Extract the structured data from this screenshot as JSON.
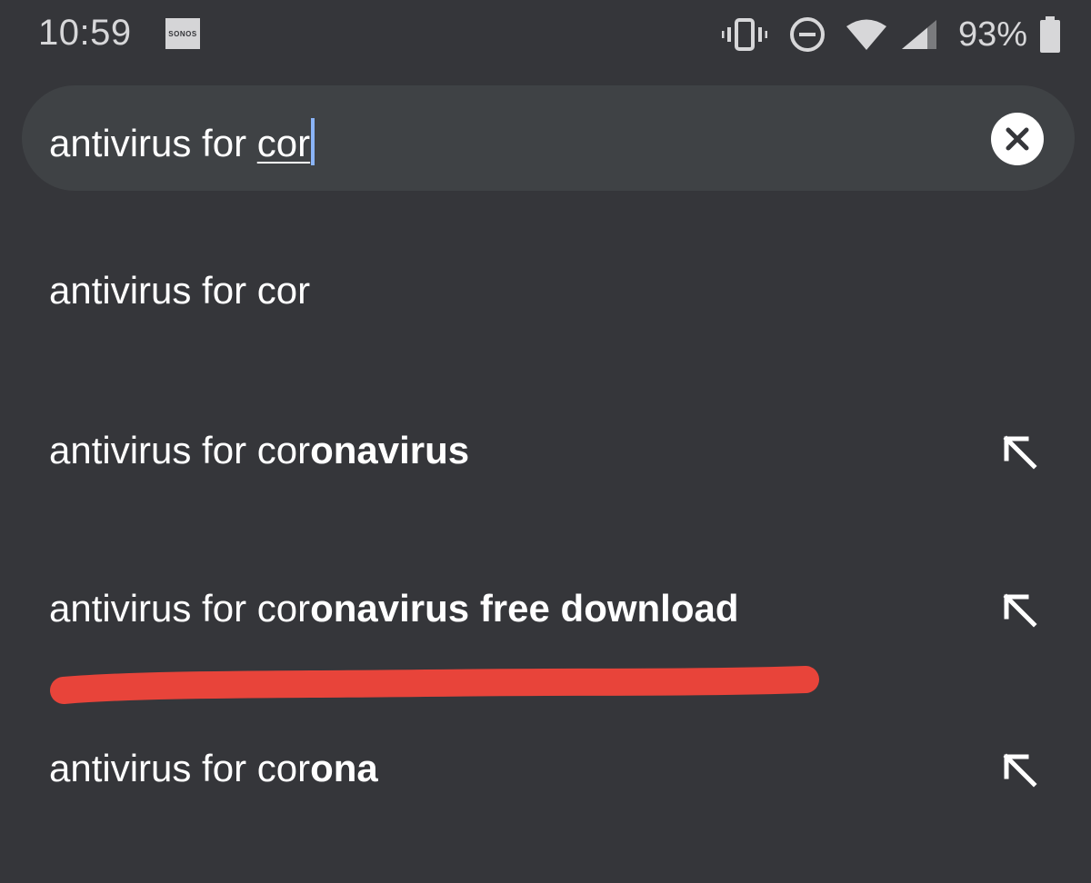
{
  "status_bar": {
    "time": "10:59",
    "notification_badge": "SONOS",
    "battery_percent": "93%",
    "icons": [
      "vibrate-icon",
      "do-not-disturb-icon",
      "wifi-icon",
      "cell-signal-icon",
      "battery-icon"
    ]
  },
  "search": {
    "prefix": "antivirus for ",
    "typed": "cor",
    "clear_icon": "close-icon"
  },
  "suggestions": [
    {
      "normal": "antivirus for cor",
      "bold": "",
      "has_fill_arrow": false
    },
    {
      "normal": "antivirus for cor",
      "bold": "onavirus",
      "has_fill_arrow": true
    },
    {
      "normal": "antivirus for cor",
      "bold": "onavirus free download",
      "has_fill_arrow": true
    },
    {
      "normal": "antivirus for cor",
      "bold": "ona",
      "has_fill_arrow": true
    }
  ],
  "colors": {
    "background": "#35363a",
    "search_box": "#3f4245",
    "caret": "#8ab4f8",
    "annotation_stroke": "#e8443a"
  }
}
